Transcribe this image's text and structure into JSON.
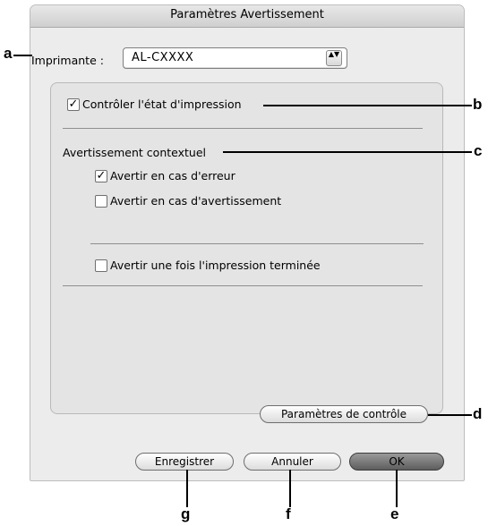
{
  "window": {
    "title": "Paramètres Avertissement"
  },
  "printer": {
    "label": "Imprimante :",
    "selected": "AL-CXXXX",
    "arrows": "▲▼"
  },
  "monitor": {
    "label": "Contrôler l'état d'impression",
    "checked": true,
    "check_glyph": "✓"
  },
  "popup_section": {
    "heading": "Avertissement contextuel",
    "options": [
      {
        "label": "Avertir en cas d'erreur",
        "checked": true
      },
      {
        "label": "Avertir en cas d'avertissement",
        "checked": false
      },
      {
        "label": "Avertir une fois l'impression terminée",
        "checked": false
      }
    ]
  },
  "buttons": {
    "monitoring_settings": "Paramètres de contrôle",
    "save": "Enregistrer",
    "cancel": "Annuler",
    "ok": "OK"
  },
  "callouts": {
    "a": "a",
    "b": "b",
    "c": "c",
    "d": "d",
    "e": "e",
    "f": "f",
    "g": "g"
  }
}
